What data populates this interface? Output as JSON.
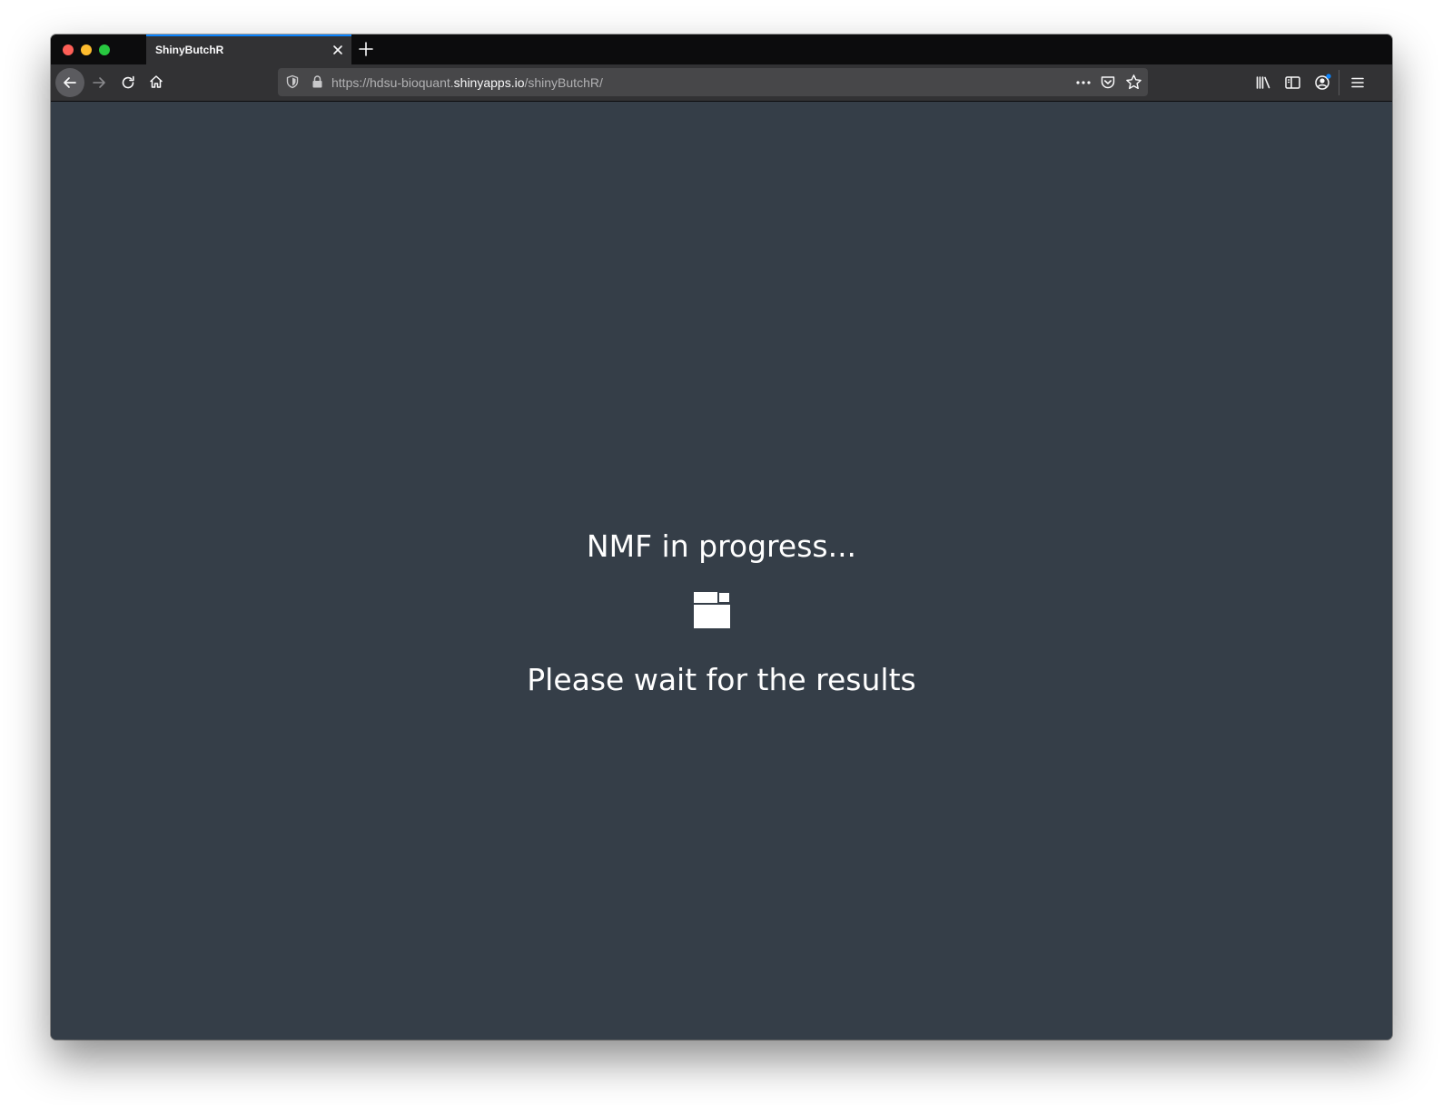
{
  "browser": {
    "tab": {
      "title": "ShinyButchR"
    },
    "url": {
      "prefix": "https://hdsu-bioquant.",
      "host": "shinyapps.io",
      "path": "/shinyButchR/"
    },
    "icons": {
      "back": "back-arrow-icon",
      "forward": "forward-arrow-icon",
      "reload": "reload-icon",
      "home": "home-icon",
      "tracking": "shield-icon",
      "lock": "lock-icon",
      "page_actions": "more-icon",
      "pocket": "pocket-icon",
      "bookmark": "star-icon",
      "library": "library-icon",
      "sidebar": "sidebar-icon",
      "account": "account-icon",
      "menu": "hamburger-menu-icon"
    },
    "colors": {
      "accent": "#0a84ff"
    }
  },
  "page": {
    "title": "NMF in progress...",
    "subtitle": "Please wait for the results",
    "colors": {
      "background": "#353e48",
      "text": "#ffffff"
    }
  }
}
